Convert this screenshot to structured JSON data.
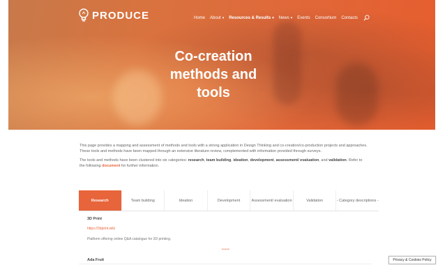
{
  "header": {
    "logo_text": "PRODUCE",
    "nav": [
      {
        "label": "Home",
        "caret": false,
        "bold": false
      },
      {
        "label": "About",
        "caret": true,
        "bold": false
      },
      {
        "label": "Resources & Results",
        "caret": true,
        "bold": true
      },
      {
        "label": "News",
        "caret": true,
        "bold": false
      },
      {
        "label": "Events",
        "caret": false,
        "bold": false
      },
      {
        "label": "Consortium",
        "caret": false,
        "bold": false
      },
      {
        "label": "Contacts",
        "caret": false,
        "bold": false
      }
    ],
    "caret_glyph": "▾"
  },
  "hero": {
    "title_line1": "Co-creation",
    "title_line2": "methods and",
    "title_line3": "tools"
  },
  "intro": {
    "p1": "This page provides a mapping and assessment of methods and tools with a strong application in Design Thinking and co-creation/co-production projects and approaches. These tools and methods have been mapped through an extensive literature review, complemented with information provided through surveys.",
    "p2_start": "The tools and methods have been clustered into six categories: ",
    "categories": [
      "research",
      "team building",
      "ideation",
      "development",
      "assessment/ evaluation",
      "validation"
    ],
    "p2_sep": ", ",
    "p2_and": ", and ",
    "p2_end": ". Refer to the following ",
    "doc_link": "document",
    "p2_tail": " for further information."
  },
  "tabs": [
    {
      "label": "Research",
      "active": true
    },
    {
      "label": "Team building",
      "active": false
    },
    {
      "label": "Ideation",
      "active": false
    },
    {
      "label": "Development",
      "active": false
    },
    {
      "label": "Assessment/ evaluation",
      "active": false
    },
    {
      "label": "Validation",
      "active": false
    },
    {
      "label": "- Category descriptions -",
      "active": false
    }
  ],
  "content": {
    "item1_title": "3D Print",
    "item1_link": "https://3dprint.wiki",
    "item1_desc": "Platform offering online Q&A catalogue for 3D printing.",
    "pager": "•••••",
    "item2_title": "Ada Fruit"
  },
  "cookie": {
    "label": "Privacy & Cookies Policy"
  },
  "colors": {
    "accent": "#e8643a"
  }
}
